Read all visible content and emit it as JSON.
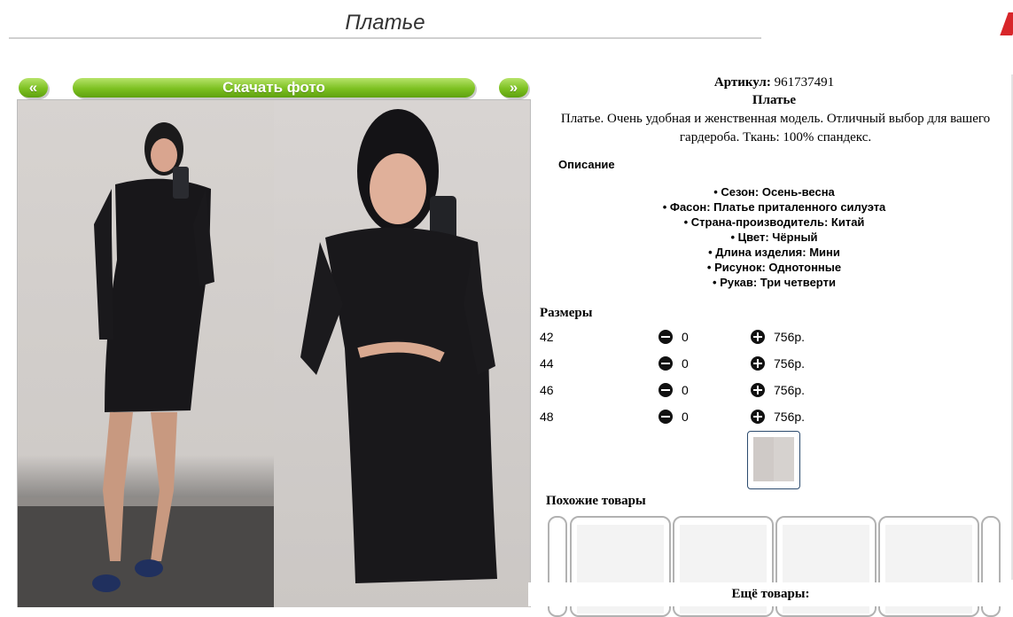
{
  "header": {
    "title": "Платье"
  },
  "gallery": {
    "prev_label": "«",
    "download_label": "Скачать фото",
    "next_label": "»"
  },
  "product": {
    "article_label": "Артикул:",
    "article_value": "961737491",
    "name": "Платье",
    "description": "Платье. Очень удобная и женственная модель. Отличный выбор для вашего гардероба. Ткань: 100% спандекс."
  },
  "description_section": {
    "heading": "Описание",
    "features": [
      "Сезон: Осень-весна",
      "Фасон: Платье приталенного силуэта",
      "Страна-производитель: Китай",
      "Цвет: Чёрный",
      "Длина изделия: Мини",
      "Рисунок: Однотонные",
      "Рукав: Три четверти"
    ]
  },
  "sizes": {
    "heading": "Размеры",
    "rows": [
      {
        "size": "42",
        "qty": "0",
        "price": "756р."
      },
      {
        "size": "44",
        "qty": "0",
        "price": "756р."
      },
      {
        "size": "46",
        "qty": "0",
        "price": "756р."
      },
      {
        "size": "48",
        "qty": "0",
        "price": "756р."
      }
    ]
  },
  "similar": {
    "heading": "Похожие товары",
    "more_label": "Ещё товары:"
  },
  "colors": {
    "accent_green": "#7cc021",
    "thumb_border": "#2c4b6e",
    "corner_red": "#d8262a"
  }
}
